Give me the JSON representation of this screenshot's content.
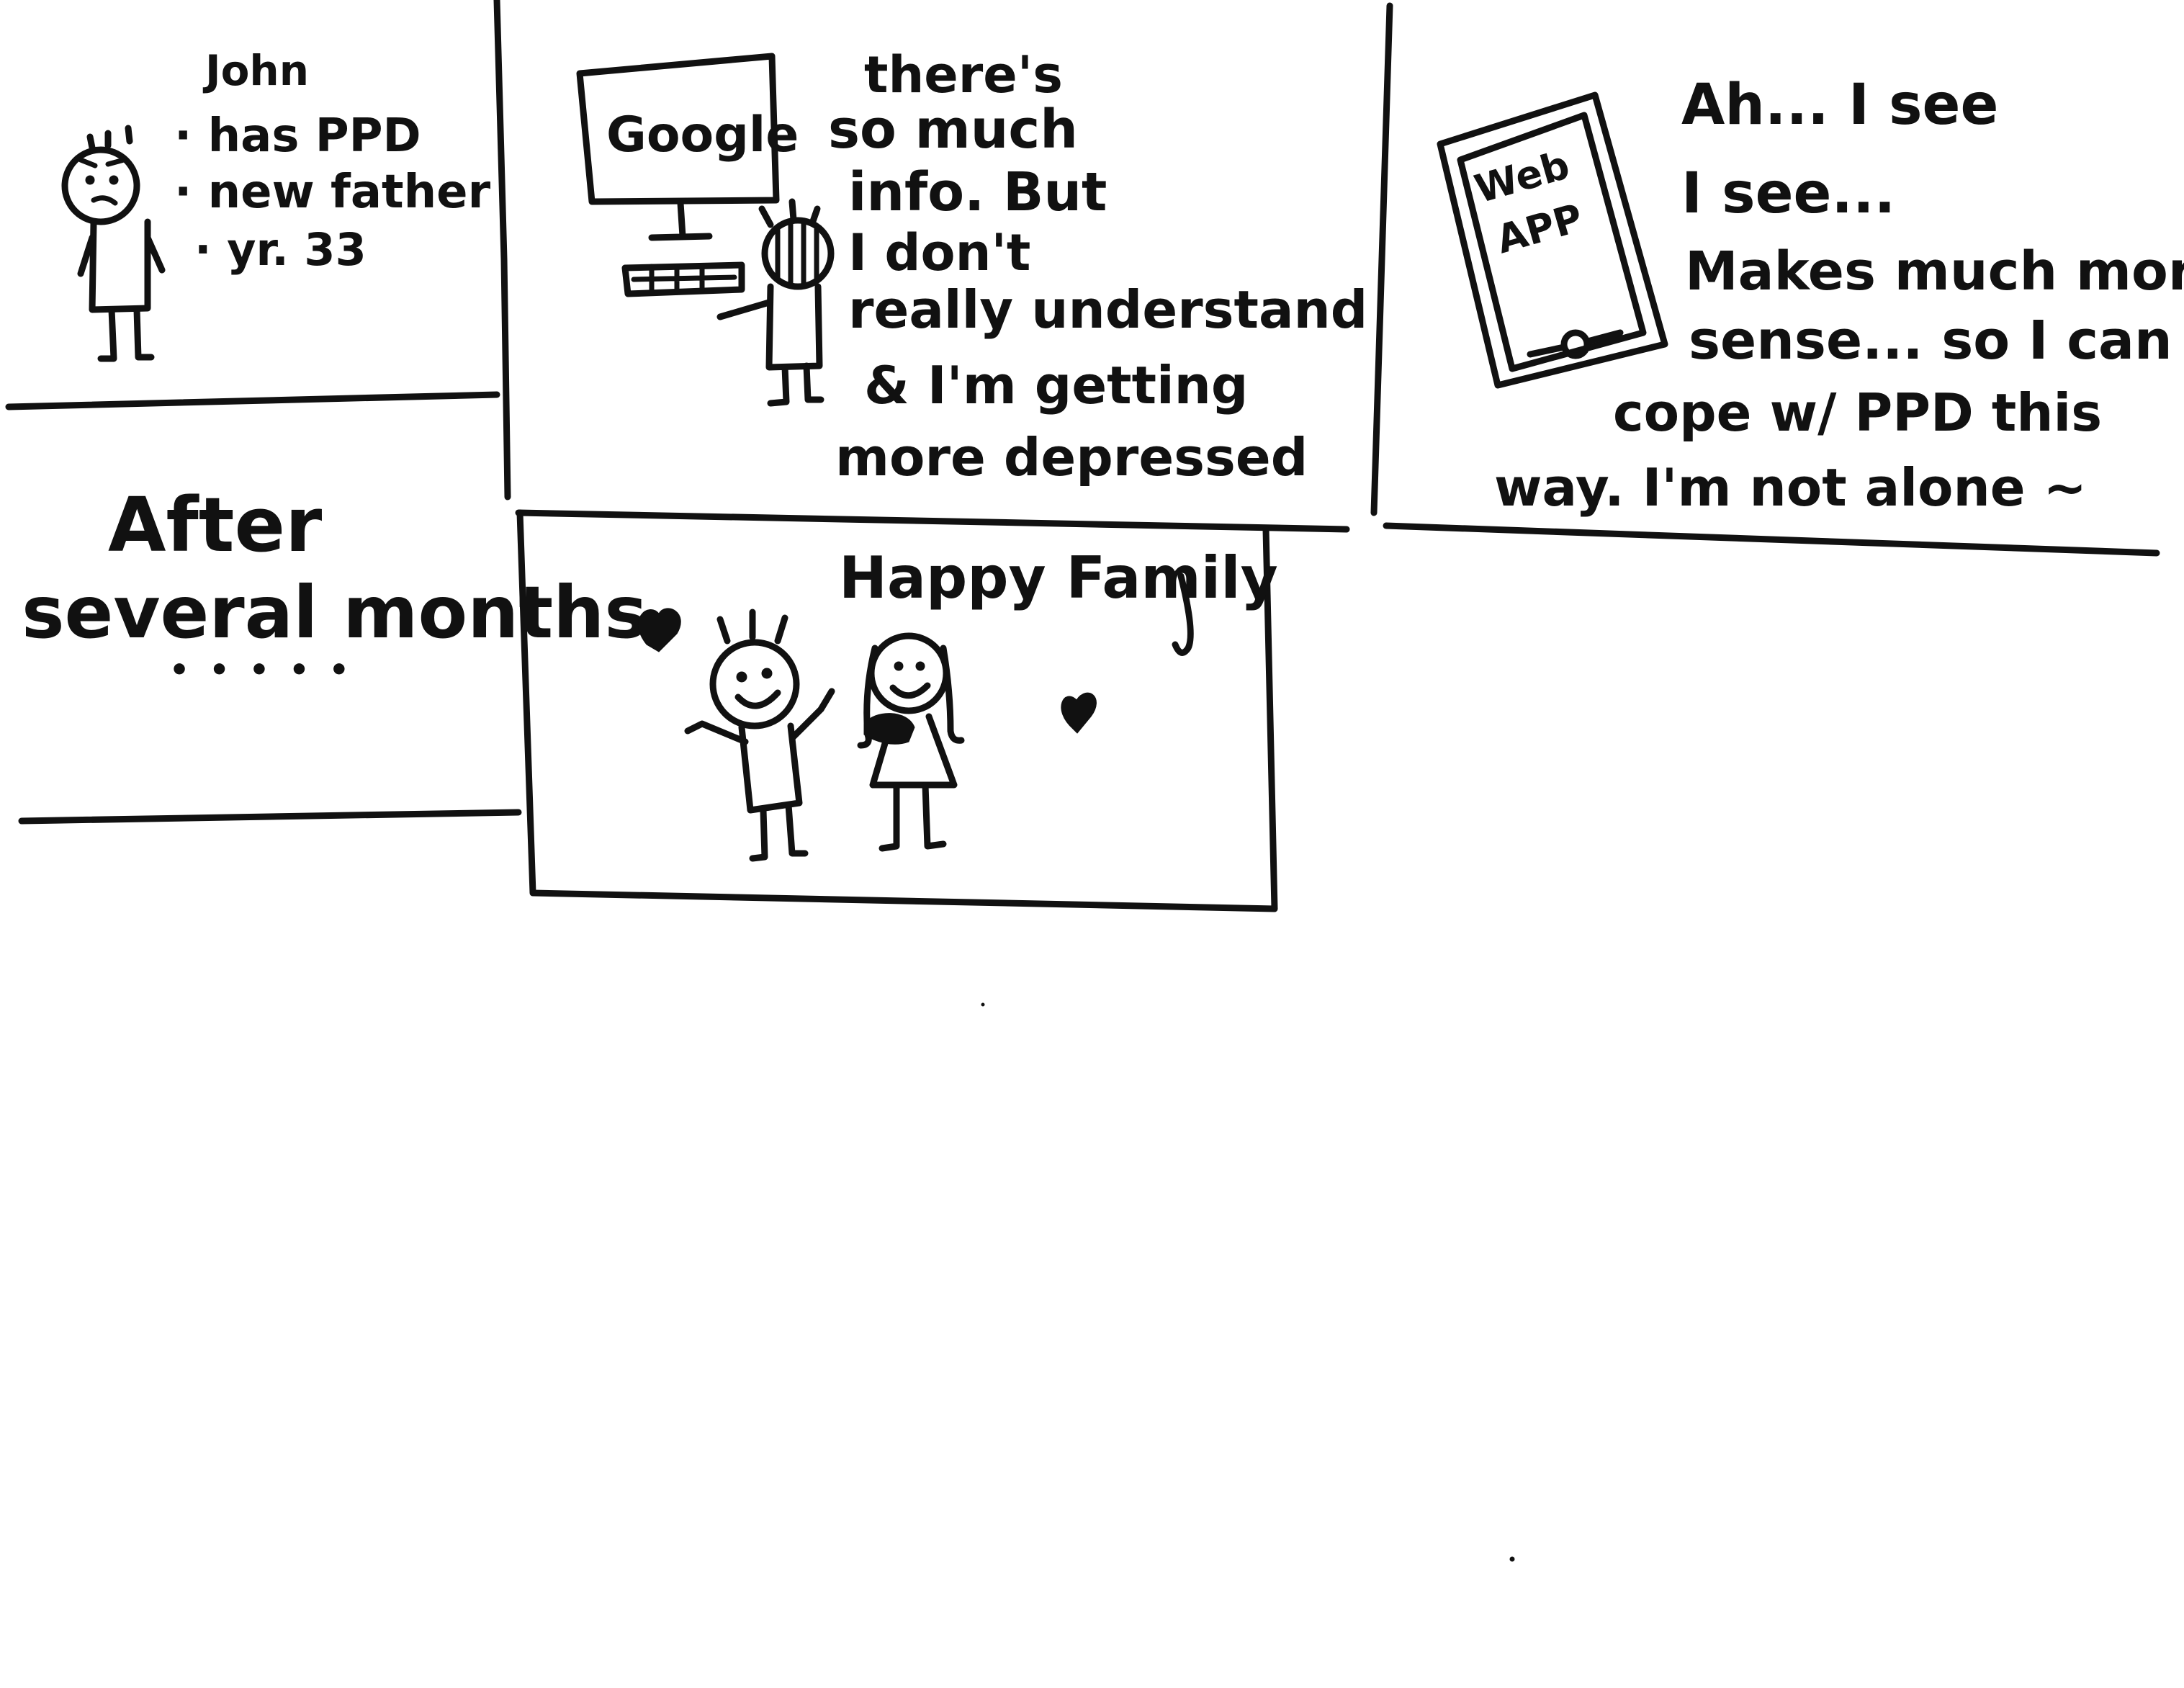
{
  "panel1": {
    "name": "John",
    "bullets": [
      "· has PPD",
      "· new father",
      "· yr. 33"
    ]
  },
  "panel2": {
    "screen_label": "Google",
    "lines": [
      "there's",
      "so much",
      "info. But",
      "I don't",
      "really understand",
      "& I'm getting",
      "more depressed"
    ]
  },
  "panel3": {
    "phone_label_1": "Web",
    "phone_label_2": "APP",
    "lines": [
      "Ah... I see",
      "I see...",
      "Makes much more",
      "sense... so I can",
      "cope w/ PPD this",
      "way. I'm not alone ~"
    ]
  },
  "panel4": {
    "lines": [
      "After",
      "several months",
      "• • • • •"
    ]
  },
  "panel5": {
    "caption": "Happy Family"
  },
  "colors": {
    "ink": "#111111",
    "paper": "#ffffff"
  }
}
